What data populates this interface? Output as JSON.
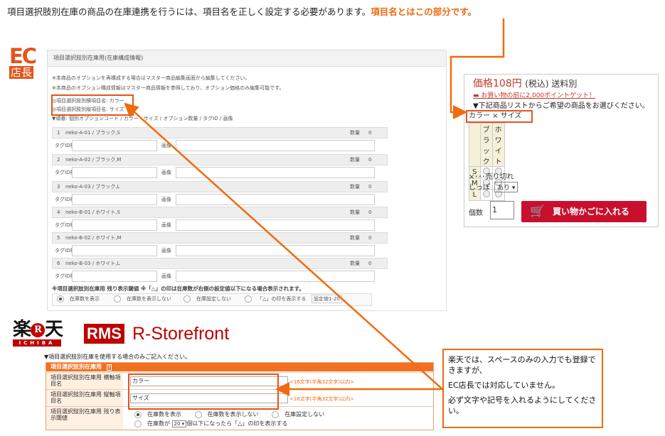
{
  "heading": {
    "text": "項目選択肢別在庫の商品の在庫連携を行うには、項目名を正しく設定する必要があります。",
    "highlight": "項目名とはこの部分です。"
  },
  "ec_logo": {
    "top": "EC",
    "bottom": "店長"
  },
  "panel": {
    "title": "項目選択肢別在庫用(在庫構成情報)",
    "notes": [
      "※本商品のオプションを再構成する場合はマスター商品編集画面から編集してください。",
      "※本商品のオプション構成情報はマスター商品情報を参照しており、オプション価格のみ編集可能です。"
    ],
    "item_name_h": "◎項目選択肢別横項目名: カラー",
    "item_name_v": "◎項目選択肢別縦項目名: サイズ",
    "order_label": "▼順番: 個別オプションコード / カラー・サイズ / オプション数量 / タグID / 画像",
    "rows": [
      {
        "num": "1",
        "code": "neko-A-01 / ブラック,S",
        "qty_label": "数量",
        "qty": "0"
      },
      {
        "num": "2",
        "code": "neko-A-02 / ブラック,M",
        "qty_label": "数量",
        "qty": "0"
      },
      {
        "num": "3",
        "code": "neko-A-03 / ブラック,L",
        "qty_label": "数量",
        "qty": "0"
      },
      {
        "num": "4",
        "code": "neko-B-01 / ホワイト,S",
        "qty_label": "数量",
        "qty": "0"
      },
      {
        "num": "5",
        "code": "neko-B-02 / ホワイト,M",
        "qty_label": "数量",
        "qty": "0"
      },
      {
        "num": "6",
        "code": "neko-B-03 / ホワイト,L",
        "qty_label": "数量",
        "qty": "0"
      }
    ],
    "tag_label": "タグID検索",
    "image_label": "画像",
    "threshold_title": "※項目選択肢別在庫用 残り表示閾値 ※「△」の印は在庫数が右側の設定値以下になる場合表示されます。",
    "radio_options": [
      "在庫数を表示",
      "在庫数を表示しない",
      "在庫設定しない",
      "「△」の印を表示する"
    ],
    "radio_selected": 0,
    "setting_value": "設定値1-20"
  },
  "product": {
    "price": "価格108円",
    "tax": "(税込) 送料別",
    "points": "お買い物の前に2,000ポイントゲット！",
    "select_prompt": "▼下記商品リストからご希望の商品をお選びください。",
    "selector_title": "カラー × サイズ",
    "colors": [
      "ブラック",
      "ホワイト"
    ],
    "sizes": [
      "S",
      "M",
      "L"
    ],
    "soldout": "×･･･売り切れ",
    "noshi_label": "しっぽ",
    "noshi_value": "あり ▾",
    "qty_label": "個数",
    "qty_value": "1",
    "cart_button": "買い物かごに入れる"
  },
  "rakuten": {
    "kanji": "楽",
    "r": "R",
    "ten": "天",
    "ichiba": "ICHIBA",
    "rms": "RMS",
    "storefront": "R-Storefront"
  },
  "rms_form": {
    "note": "▼項目選択肢別在庫を使用する場合のみご記入ください。",
    "header": "項目選択肢別在庫用",
    "header_icon": "?",
    "row1_label": "項目選択肢別在庫用 横軸項目名",
    "row1_value": "カラー",
    "row1_hint": "<16文字(半角32文字)以内>",
    "row2_label": "項目選択肢別在庫用 縦軸項目名",
    "row2_value": "サイズ",
    "row2_hint": "<16文字(半角32文字)以内>",
    "row3_label": "項目選択肢別在庫用 残り表示閾値",
    "row3_opt1": "在庫数を表示",
    "row3_opt2": "在庫数を表示しない",
    "row3_opt3": "在庫設定しない",
    "row3_line2_prefix": "在庫数が",
    "row3_line2_value": "20 ▾",
    "row3_line2_suffix": "個以下になったら「△」の印を表示する"
  },
  "callout": {
    "p1": "楽天では、スペースのみの入力でも登録できますが、",
    "p2": "EC店長では対応していません。",
    "p3": "必ず文字や記号を入れるようにしてください。"
  },
  "colors": {
    "accent": "#f06a0f",
    "rakuten_red": "#bf0000",
    "cart_red": "#c8102e"
  }
}
